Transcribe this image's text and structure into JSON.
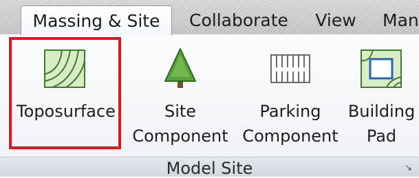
{
  "ribbon": {
    "tabs": [
      {
        "label": "Massing & Site",
        "active": true
      },
      {
        "label": "Collaborate",
        "active": false
      },
      {
        "label": "View",
        "active": false
      },
      {
        "label": "Man",
        "active": false
      }
    ]
  },
  "panel": {
    "title": "Model Site",
    "launcher_icon": "dialog-launcher-icon",
    "tools": [
      {
        "icon": "toposurface-icon",
        "label": "Toposurface",
        "highlighted": true
      },
      {
        "icon": "tree-icon",
        "label_lines": [
          "Site",
          "Component"
        ]
      },
      {
        "icon": "parking-icon",
        "label_lines": [
          "Parking",
          "Component"
        ]
      },
      {
        "icon": "building-pad-icon",
        "label_lines": [
          "Building",
          "Pad"
        ]
      }
    ]
  },
  "colors": {
    "highlight": "#e4141c",
    "icon_green": "#6aa84f",
    "icon_fill": "#cfe6b8"
  }
}
